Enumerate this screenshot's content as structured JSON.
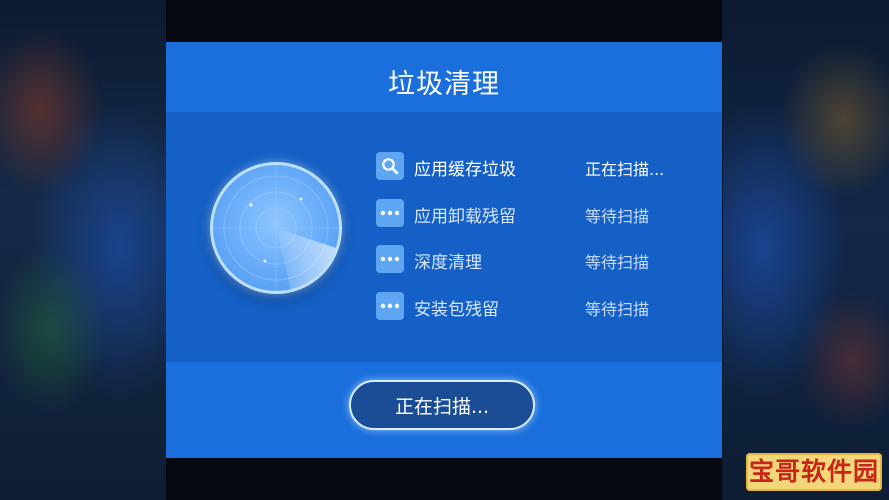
{
  "dialog": {
    "title": "垃圾清理"
  },
  "scan_items": [
    {
      "label": "应用缓存垃圾",
      "status": "正在扫描...",
      "icon": "search-icon",
      "active": true
    },
    {
      "label": "应用卸载残留",
      "status": "等待扫描",
      "icon": "more-dots-icon",
      "active": false
    },
    {
      "label": "深度清理",
      "status": "等待扫描",
      "icon": "more-dots-icon",
      "active": false
    },
    {
      "label": "安装包残留",
      "status": "等待扫描",
      "icon": "more-dots-icon",
      "active": false
    }
  ],
  "button": {
    "label": "正在扫描..."
  },
  "watermark": {
    "text": "宝哥软件园"
  },
  "colors": {
    "dialog_bg": "#1a6fdc",
    "panel_bg": "#1560c6",
    "button_bg": "#1a4d96",
    "watermark_bg": "#f2d77a",
    "watermark_text": "#c8261a"
  }
}
